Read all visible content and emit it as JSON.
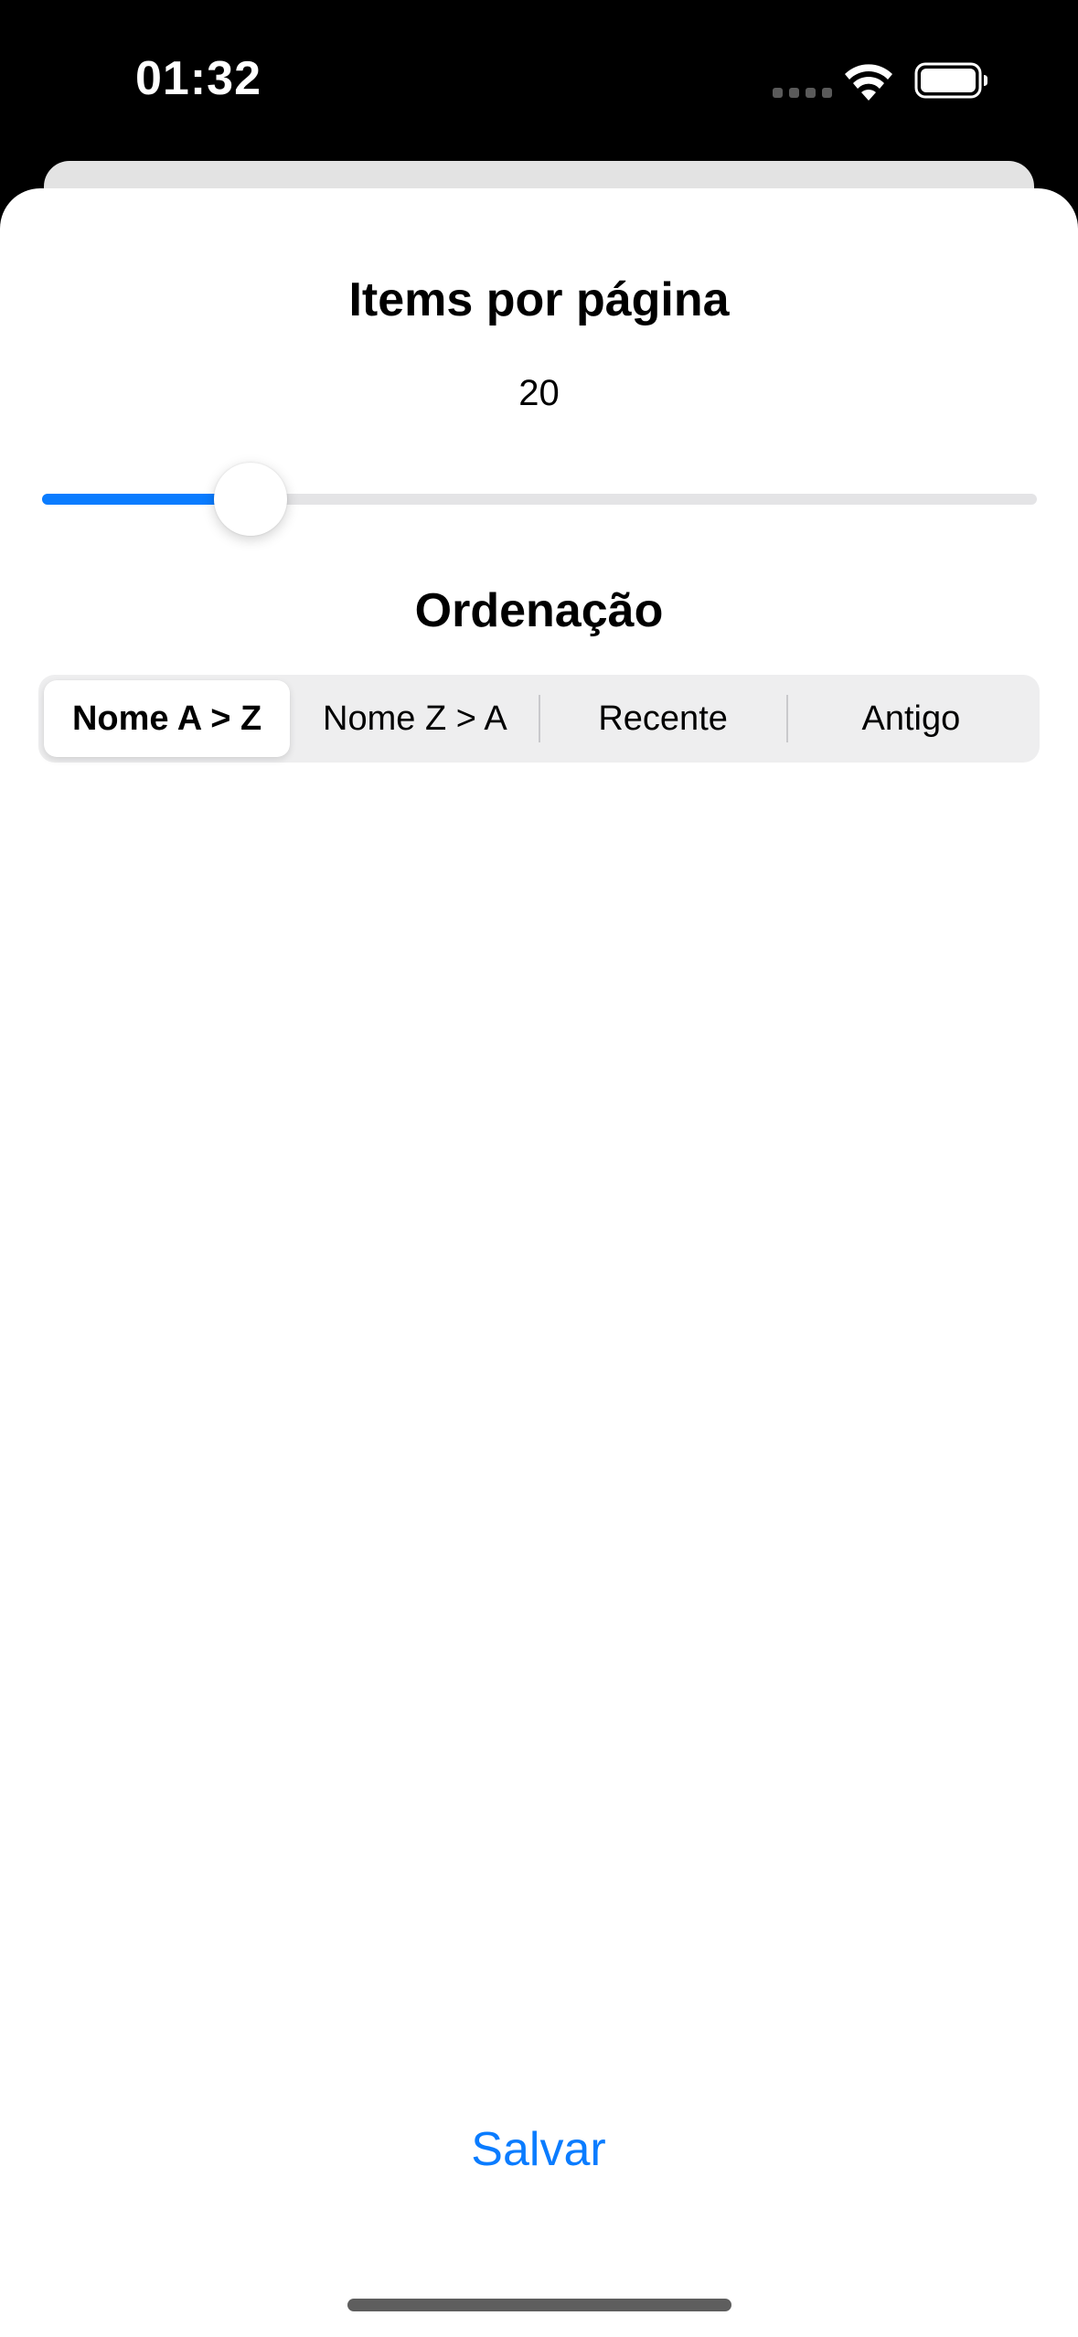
{
  "status_bar": {
    "time": "01:32"
  },
  "items_per_page": {
    "title": "Items por página",
    "value": "20",
    "slider_fraction": 0.21
  },
  "ordering": {
    "title": "Ordenação",
    "options": [
      "Nome A > Z",
      "Nome Z > A",
      "Recente",
      "Antigo"
    ],
    "selected": "Nome A > Z"
  },
  "actions": {
    "save_label": "Salvar"
  },
  "colors": {
    "accent": "#0a7cff",
    "sheet": "#ffffff",
    "track": "#e4e4e6",
    "segment_bg": "#eeeeef"
  },
  "icons": [
    "signal-dots-icon",
    "wifi-icon",
    "battery-icon"
  ]
}
